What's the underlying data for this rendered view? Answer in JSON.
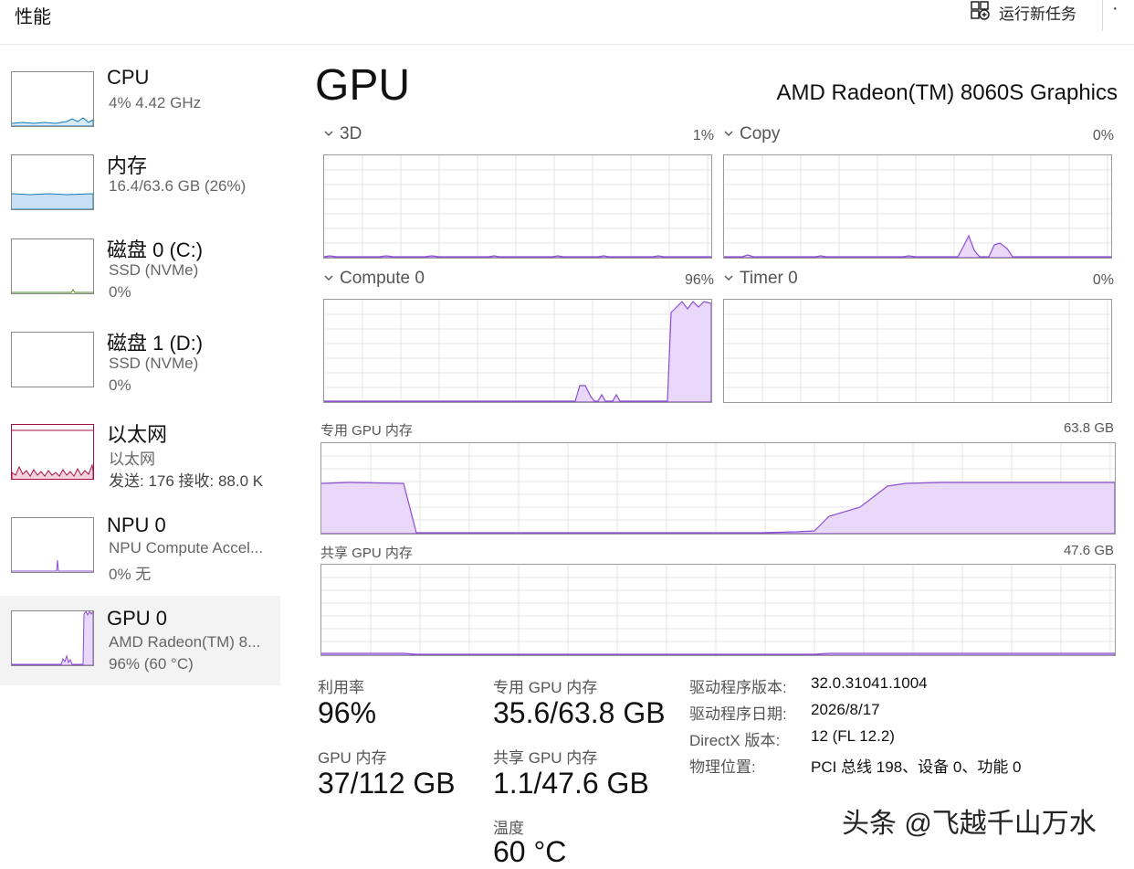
{
  "header": {
    "title": "性能",
    "new_task_label": "运行新任务",
    "more_label": "·"
  },
  "sidebar": {
    "items": [
      {
        "name": "CPU",
        "line1": "4% 4.42 GHz",
        "line2": ""
      },
      {
        "name": "内存",
        "line1": "16.4/63.6 GB (26%)",
        "line2": ""
      },
      {
        "name": "磁盘 0 (C:)",
        "line1": "SSD (NVMe)",
        "line2": "0%"
      },
      {
        "name": "磁盘 1 (D:)",
        "line1": "SSD (NVMe)",
        "line2": "0%"
      },
      {
        "name": "以太网",
        "line1": "以太网",
        "line2": "发送: 176 接收: 88.0 K"
      },
      {
        "name": "NPU 0",
        "line1": "NPU Compute Accel...",
        "line2": "0% 无"
      },
      {
        "name": "GPU 0",
        "line1": "AMD Radeon(TM) 8...",
        "line2": "96% (60 °C)"
      }
    ]
  },
  "main": {
    "title": "GPU",
    "adapter": "AMD Radeon(TM) 8060S Graphics",
    "engines": [
      {
        "label": "3D",
        "percent": "1%"
      },
      {
        "label": "Copy",
        "percent": "0%"
      },
      {
        "label": "Compute 0",
        "percent": "96%"
      },
      {
        "label": "Timer 0",
        "percent": "0%"
      }
    ],
    "dedicated_label": "专用 GPU 内存",
    "dedicated_max": "63.8 GB",
    "shared_label": "共享 GPU 内存",
    "shared_max": "47.6 GB"
  },
  "stats": {
    "util_label": "利用率",
    "util_value": "96%",
    "gpu_mem_label": "GPU 内存",
    "gpu_mem_value": "37/112 GB",
    "ded_label": "专用 GPU 内存",
    "ded_value": "35.6/63.8 GB",
    "shared_label": "共享 GPU 内存",
    "shared_value": "1.1/47.6 GB",
    "temp_label": "温度",
    "temp_value": "60 °C"
  },
  "details": [
    {
      "key": "驱动程序版本:",
      "value": "32.0.31041.1004"
    },
    {
      "key": "驱动程序日期:",
      "value": "2026/8/17"
    },
    {
      "key": "DirectX 版本:",
      "value": "12 (FL 12.2)"
    },
    {
      "key": "物理位置:",
      "value": "PCI 总线 198、设备 0、功能 0"
    }
  ],
  "watermark": "头条 @飞越千山万水",
  "colors": {
    "gpu_line": "#8b4fd1",
    "gpu_fill": "#ead8fb",
    "cpu_line": "#117dbb",
    "mem_fill": "#c9dff3",
    "net_line": "#a4123f",
    "grid": "#e4e4e4"
  },
  "icons": {
    "new_task": "new-task-icon",
    "chevron": "chevron-down-icon"
  }
}
